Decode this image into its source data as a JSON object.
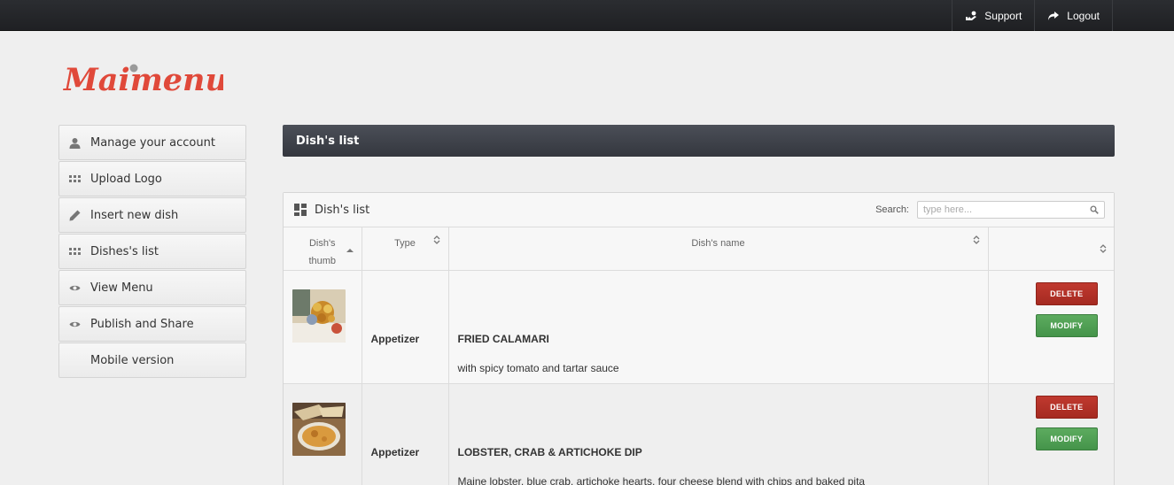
{
  "topbar": {
    "support_label": "Support",
    "logout_label": "Logout"
  },
  "logo": {
    "text": "Maimenu",
    "color": "#e0493a"
  },
  "sidebar": {
    "items": [
      {
        "label": "Manage your account",
        "icon": "user-icon"
      },
      {
        "label": "Upload Logo",
        "icon": "grid-icon"
      },
      {
        "label": "Insert new dish",
        "icon": "pencil-icon"
      },
      {
        "label": "Dishes's list",
        "icon": "grid-icon"
      },
      {
        "label": "View Menu",
        "icon": "eye-icon"
      },
      {
        "label": "Publish and Share",
        "icon": "eye-icon"
      },
      {
        "label": "Mobile version",
        "icon": ""
      }
    ]
  },
  "main": {
    "title": "Dish's list",
    "panel": {
      "title": "Dish's list",
      "search_label": "Search:",
      "search_placeholder": "type here...",
      "columns": [
        "Dish's thumb",
        "Type",
        "Dish's name",
        ""
      ],
      "rows": [
        {
          "type": "Appetizer",
          "name": "FRIED CALAMARI",
          "description": "with spicy tomato and tartar sauce",
          "delete_label": "DELETE",
          "modify_label": "MODIFY"
        },
        {
          "type": "Appetizer",
          "name": "LOBSTER, CRAB & ARTICHOKE DIP",
          "description": "Maine lobster, blue crab, artichoke hearts, four cheese blend with chips and baked pita",
          "delete_label": "DELETE",
          "modify_label": "MODIFY"
        }
      ]
    }
  },
  "colors": {
    "topbar": "#232427",
    "delete": "#b33328",
    "modify": "#4fa052",
    "titlebar": "#3f434b"
  }
}
